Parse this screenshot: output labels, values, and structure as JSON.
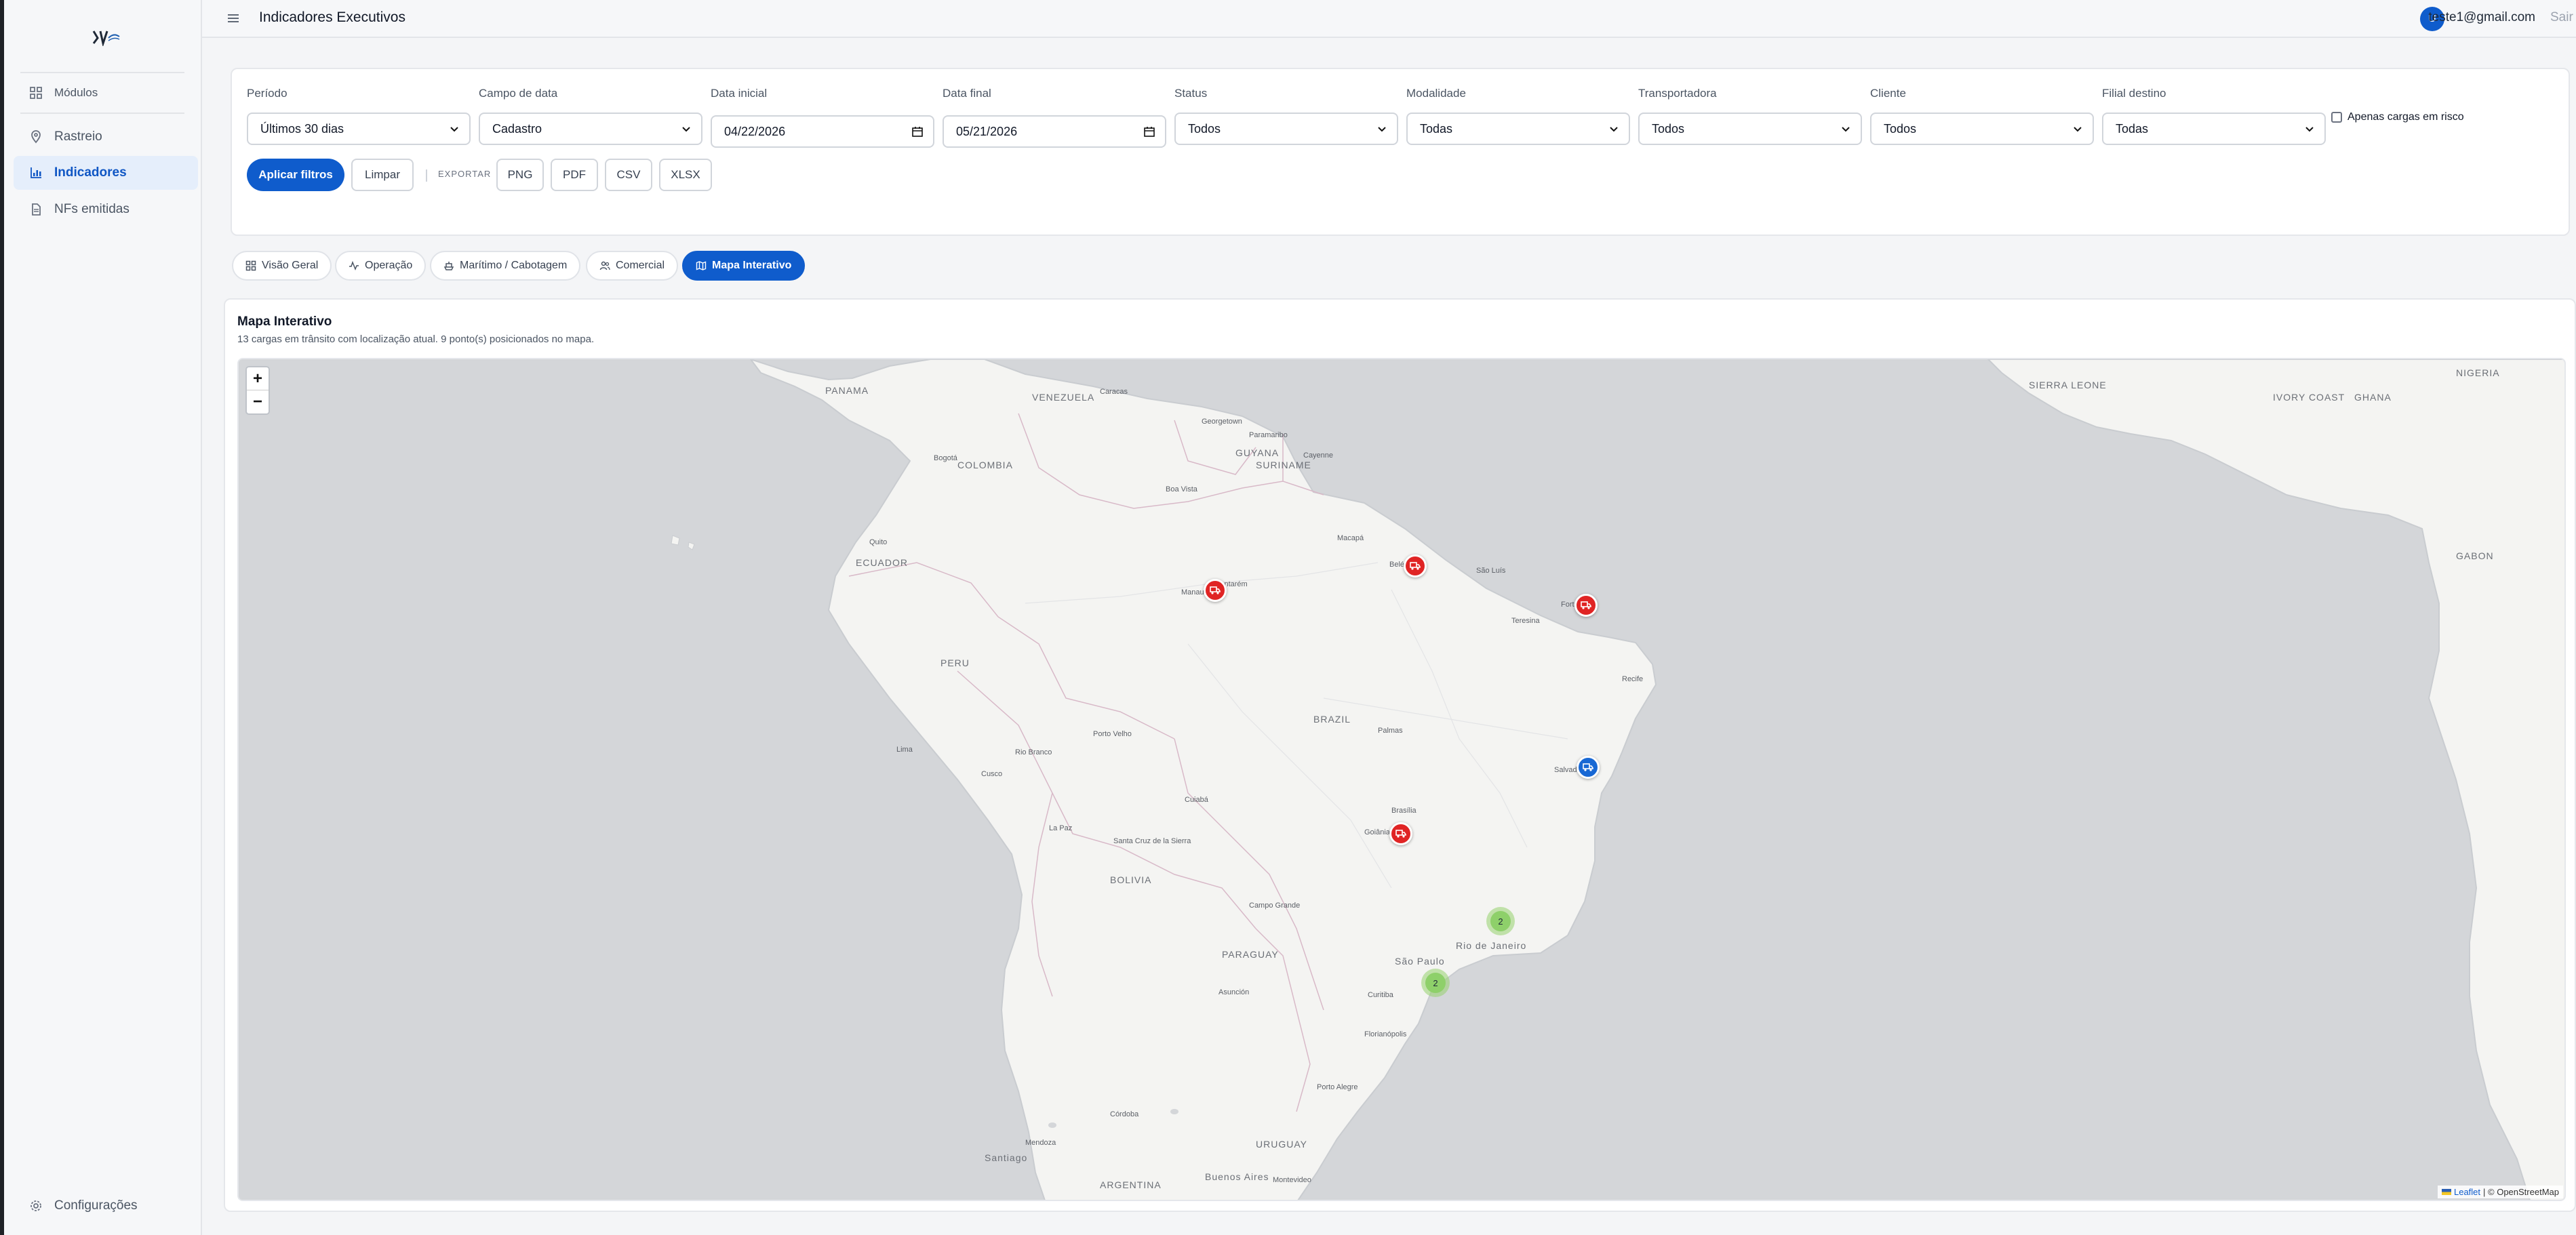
{
  "app": {
    "title": "Indicadores Executivos"
  },
  "user": {
    "initial": "U",
    "email": "teste1@gmail.com",
    "logout_label": "Sair"
  },
  "sidebar": {
    "items": [
      {
        "label": "Módulos",
        "icon": "grid-icon"
      },
      {
        "label": "Rastreio",
        "icon": "pin-icon"
      },
      {
        "label": "Indicadores",
        "icon": "bar-chart-icon",
        "active": true
      },
      {
        "label": "NFs emitidas",
        "icon": "document-icon"
      }
    ],
    "footer": {
      "label": "Configurações",
      "icon": "gear-icon"
    }
  },
  "filters": {
    "periodo": {
      "label": "Período",
      "value": "Últimos 30 dias"
    },
    "campo_data": {
      "label": "Campo de data",
      "value": "Cadastro"
    },
    "data_inicial": {
      "label": "Data inicial",
      "value": "04/22/2026"
    },
    "data_final": {
      "label": "Data final",
      "value": "05/21/2026"
    },
    "status": {
      "label": "Status",
      "value": "Todos"
    },
    "modalidade": {
      "label": "Modalidade",
      "value": "Todas"
    },
    "transportadora": {
      "label": "Transportadora",
      "value": "Todos"
    },
    "cliente": {
      "label": "Cliente",
      "value": "Todos"
    },
    "filial_destino": {
      "label": "Filial destino",
      "value": "Todas"
    },
    "risk_only": {
      "label": "Apenas cargas em risco",
      "checked": false
    },
    "apply_label": "Aplicar filtros",
    "clear_label": "Limpar",
    "export_label": "EXPORTAR",
    "export_formats": [
      "PNG",
      "PDF",
      "CSV",
      "XLSX"
    ]
  },
  "tabs": [
    {
      "label": "Visão Geral",
      "icon": "dashboard-icon"
    },
    {
      "label": "Operação",
      "icon": "activity-icon"
    },
    {
      "label": "Marítimo / Cabotagem",
      "icon": "ship-icon"
    },
    {
      "label": "Comercial",
      "icon": "users-icon"
    },
    {
      "label": "Mapa Interativo",
      "icon": "map-icon",
      "active": true
    }
  ],
  "map": {
    "title": "Mapa Interativo",
    "subtitle": "13 cargas em trânsito com localização atual. 9 ponto(s) posicionados no mapa.",
    "zoom_in": "+",
    "zoom_out": "−",
    "attribution_leaflet": "Leaflet",
    "attribution_rest": "| © OpenStreetMap",
    "cluster_counts": [
      "2",
      "2"
    ],
    "country_labels": [
      "VENEZUELA",
      "COLOMBIA",
      "GUYANA",
      "SURINAME",
      "ECUADOR",
      "PERU",
      "BRAZIL",
      "BOLIVIA",
      "PARAGUAY",
      "URUGUAY",
      "ARGENTINA",
      "PANAMA",
      "NIGERIA",
      "GHANA",
      "GABON",
      "IVORY COAST",
      "SIERRA LEONE"
    ],
    "city_labels": [
      "Bogotá",
      "Quito",
      "Lima",
      "Cusco",
      "La Paz",
      "Santa Cruz de la Sierra",
      "Manaus",
      "Belém",
      "Santarém",
      "Fortaleza",
      "Recife",
      "Salvador",
      "Brasília",
      "Goiânia",
      "Campo Grande",
      "São Paulo",
      "Rio de Janeiro",
      "Curitiba",
      "Florianópolis",
      "Porto Alegre",
      "Asunción",
      "Córdoba",
      "Montevideo",
      "Buenos Aires",
      "Santiago",
      "Mendoza",
      "Caracas",
      "Georgetown",
      "Paramaribo",
      "Cayenne",
      "Macapá",
      "Boa Vista",
      "São Luís",
      "Teresina",
      "Palmas",
      "Cuiabá",
      "Porto Velho",
      "Rio Branco"
    ]
  }
}
